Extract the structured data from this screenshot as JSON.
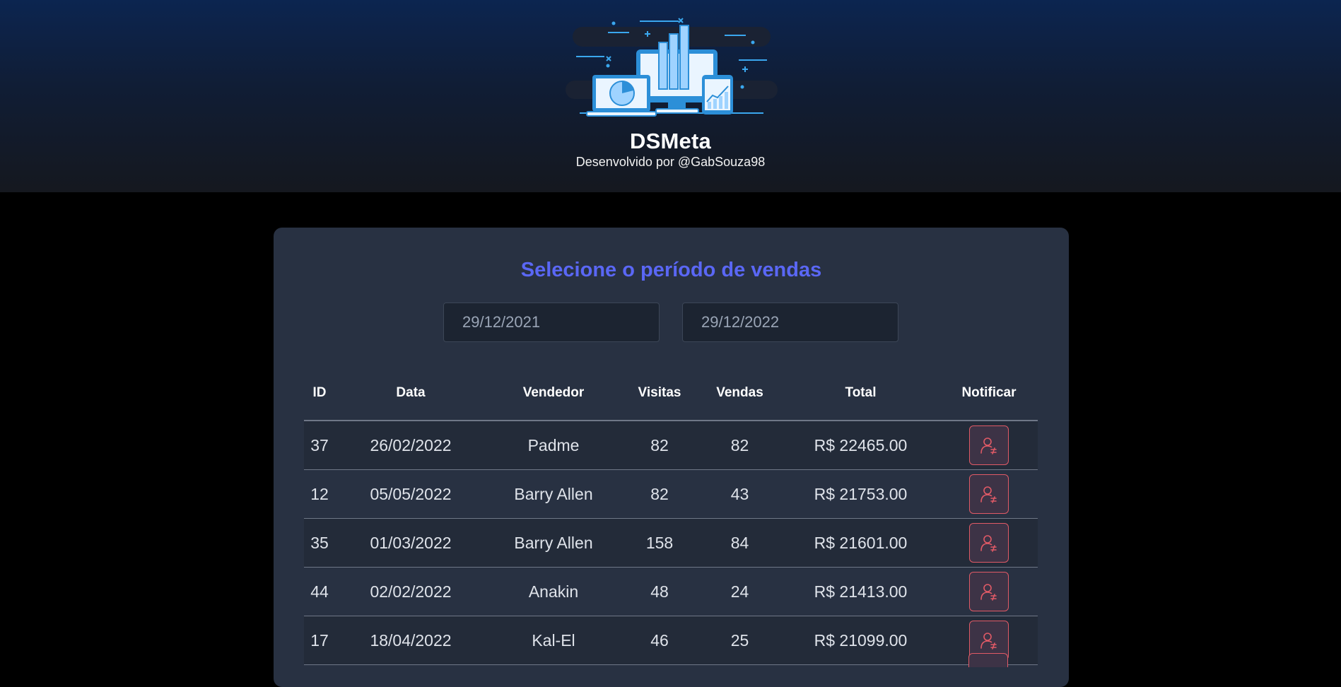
{
  "header": {
    "title": "DSMeta",
    "subtitle": "Desenvolvido por @GabSouza98",
    "logo_icon": "dashboard-devices-illustration"
  },
  "card": {
    "title": "Selecione o período de vendas",
    "min_date": "29/12/2021",
    "max_date": "29/12/2022"
  },
  "table": {
    "headers": [
      "ID",
      "Data",
      "Vendedor",
      "Visitas",
      "Vendas",
      "Total",
      "Notificar"
    ],
    "rows": [
      {
        "id": "37",
        "date": "26/02/2022",
        "seller": "Padme",
        "visits": "82",
        "sales": "82",
        "total": "R$ 22465.00"
      },
      {
        "id": "12",
        "date": "05/05/2022",
        "seller": "Barry Allen",
        "visits": "82",
        "sales": "43",
        "total": "R$ 21753.00"
      },
      {
        "id": "35",
        "date": "01/03/2022",
        "seller": "Barry Allen",
        "visits": "158",
        "sales": "84",
        "total": "R$ 21601.00"
      },
      {
        "id": "44",
        "date": "02/02/2022",
        "seller": "Anakin",
        "visits": "48",
        "sales": "24",
        "total": "R$ 21413.00"
      },
      {
        "id": "17",
        "date": "18/04/2022",
        "seller": "Kal-El",
        "visits": "46",
        "sales": "25",
        "total": "R$ 21099.00"
      }
    ],
    "notify_icon": "user-notify-icon"
  },
  "colors": {
    "accent": "#5a67f5",
    "notify_red": "#e05a66",
    "card_bg": "#283142",
    "page_bg": "#000000"
  }
}
